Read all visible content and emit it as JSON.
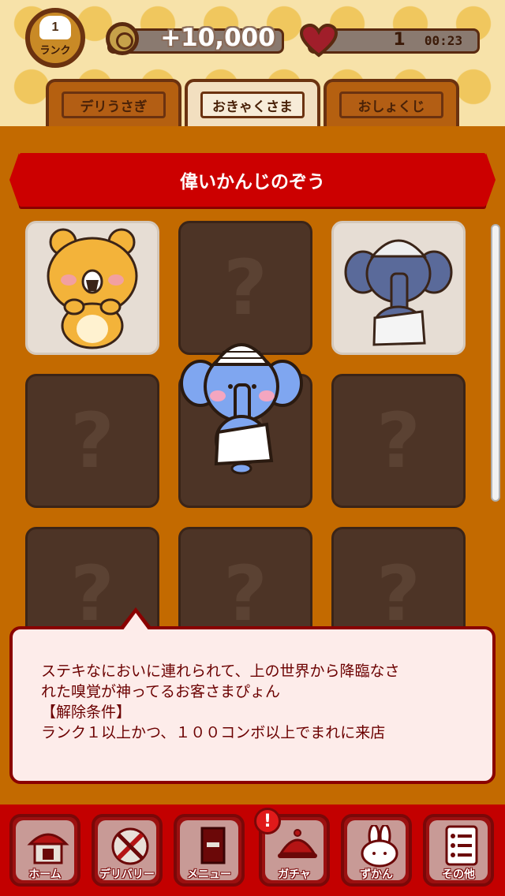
{
  "header": {
    "rank_value": "1",
    "rank_label": "ランク",
    "coins": "+10,000",
    "lives": "1",
    "timer": "00:23"
  },
  "tabs": [
    {
      "label": "デリうさぎ",
      "active": false
    },
    {
      "label": "おきゃくさま",
      "active": true
    },
    {
      "label": "おしょくじ",
      "active": false
    }
  ],
  "detail": {
    "title": "偉いかんじのぞう",
    "description_line1": "ステキなにおいに連れられて、上の世界から降臨なさ",
    "description_line2": "れた嗅覚が神ってるお客さまぴょん",
    "condition_header": "【解除条件】",
    "condition_text": "ランク１以上かつ、１００コンボ以上でまれに来店"
  },
  "grid": [
    {
      "name": "bear",
      "unlocked": true,
      "mark": ""
    },
    {
      "name": "locked",
      "unlocked": false,
      "mark": "?"
    },
    {
      "name": "elephant",
      "unlocked": true,
      "mark": ""
    },
    {
      "name": "locked",
      "unlocked": false,
      "mark": "?"
    },
    {
      "name": "locked",
      "unlocked": false,
      "mark": "?"
    },
    {
      "name": "locked",
      "unlocked": false,
      "mark": "?"
    },
    {
      "name": "locked",
      "unlocked": false,
      "mark": "?"
    },
    {
      "name": "locked",
      "unlocked": false,
      "mark": "?"
    },
    {
      "name": "locked",
      "unlocked": false,
      "mark": "?"
    }
  ],
  "nav": [
    {
      "label": "ホーム",
      "icon": "home-icon"
    },
    {
      "label": "デリバリー",
      "icon": "delivery-icon"
    },
    {
      "label": "メニュー",
      "icon": "menu-book-icon"
    },
    {
      "label": "ガチャ",
      "icon": "cloche-icon"
    },
    {
      "label": "ずかん",
      "icon": "rabbit-icon"
    },
    {
      "label": "その他",
      "icon": "list-icon"
    }
  ],
  "alert": "!",
  "colors": {
    "ribbon": "#cc0000",
    "panel": "#c36a00",
    "nav": "#c30000",
    "text_dark_red": "#6b0000"
  }
}
